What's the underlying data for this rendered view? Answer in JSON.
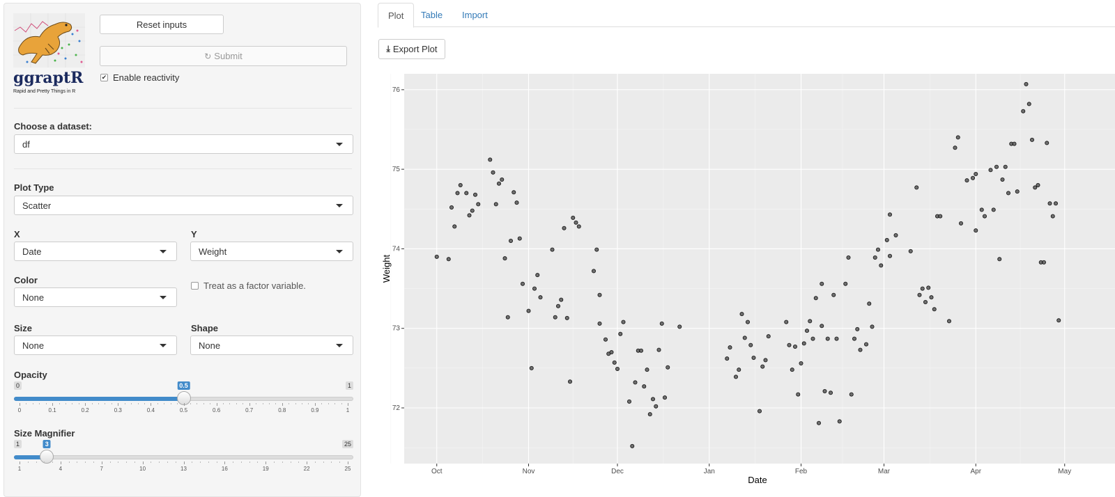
{
  "app": {
    "logo_title": "ggraptR",
    "logo_subtitle": "Rapid and Pretty Things in R"
  },
  "controls": {
    "reset_label": "Reset inputs",
    "submit_label": "Submit",
    "reactivity_label": "Enable reactivity",
    "reactivity_checked": true,
    "dataset_label": "Choose a dataset:",
    "dataset_value": "df",
    "plot_type_label": "Plot Type",
    "plot_type_value": "Scatter",
    "x_label": "X",
    "x_value": "Date",
    "y_label": "Y",
    "y_value": "Weight",
    "color_label": "Color",
    "color_value": "None",
    "factor_label": "Treat as a factor variable.",
    "factor_checked": false,
    "size_label": "Size",
    "size_value": "None",
    "shape_label": "Shape",
    "shape_value": "None"
  },
  "opacity_slider": {
    "label": "Opacity",
    "min": 0,
    "max": 1,
    "value": 0.5,
    "min_label": "0",
    "max_label": "1",
    "value_label": "0.5",
    "ticks": [
      "0",
      "0.1",
      "0.2",
      "0.3",
      "0.4",
      "0.5",
      "0.6",
      "0.7",
      "0.8",
      "0.9",
      "1"
    ]
  },
  "size_slider": {
    "label": "Size Magnifier",
    "min": 1,
    "max": 25,
    "value": 3,
    "min_label": "1",
    "max_label": "25",
    "value_label": "3",
    "ticks": [
      "1",
      "4",
      "7",
      "10",
      "13",
      "16",
      "19",
      "22",
      "25"
    ]
  },
  "tabs": [
    {
      "label": "Plot",
      "active": true
    },
    {
      "label": "Table",
      "active": false
    },
    {
      "label": "Import",
      "active": false
    }
  ],
  "export_label": "Export Plot",
  "colors": {
    "accent": "#428bca",
    "panel_bg": "#ebebeb",
    "point_fill": "#595959"
  },
  "chart_data": {
    "type": "scatter",
    "xlabel": "Date",
    "ylabel": "Weight",
    "x_ticks": [
      "Oct",
      "Nov",
      "Dec",
      "Jan",
      "Feb",
      "Mar",
      "Apr",
      "May"
    ],
    "x_tick_dates": [
      "2014-10-01",
      "2014-11-01",
      "2014-12-01",
      "2015-01-01",
      "2015-02-01",
      "2015-03-01",
      "2015-04-01",
      "2015-05-01"
    ],
    "y_ticks": [
      72,
      73,
      74,
      75,
      76
    ],
    "xlim": [
      "2014-09-20",
      "2015-05-18"
    ],
    "ylim": [
      71.3,
      76.2
    ],
    "grid": true,
    "points": [
      [
        "2014-10-01",
        73.9
      ],
      [
        "2014-10-05",
        73.87
      ],
      [
        "2014-10-06",
        74.52
      ],
      [
        "2014-10-07",
        74.28
      ],
      [
        "2014-10-08",
        74.7
      ],
      [
        "2014-10-09",
        74.8
      ],
      [
        "2014-10-11",
        74.7
      ],
      [
        "2014-10-12",
        74.42
      ],
      [
        "2014-10-13",
        74.48
      ],
      [
        "2014-10-14",
        74.68
      ],
      [
        "2014-10-15",
        74.56
      ],
      [
        "2014-10-19",
        75.12
      ],
      [
        "2014-10-20",
        74.96
      ],
      [
        "2014-10-21",
        74.56
      ],
      [
        "2014-10-22",
        74.82
      ],
      [
        "2014-10-23",
        74.87
      ],
      [
        "2014-10-24",
        73.88
      ],
      [
        "2014-10-25",
        73.14
      ],
      [
        "2014-10-26",
        74.1
      ],
      [
        "2014-10-27",
        74.71
      ],
      [
        "2014-10-28",
        74.58
      ],
      [
        "2014-10-29",
        74.13
      ],
      [
        "2014-10-30",
        73.56
      ],
      [
        "2014-11-01",
        73.22
      ],
      [
        "2014-11-02",
        72.5
      ],
      [
        "2014-11-03",
        73.5
      ],
      [
        "2014-11-04",
        73.67
      ],
      [
        "2014-11-05",
        73.39
      ],
      [
        "2014-11-09",
        73.99
      ],
      [
        "2014-11-10",
        73.14
      ],
      [
        "2014-11-11",
        73.28
      ],
      [
        "2014-11-12",
        73.36
      ],
      [
        "2014-11-13",
        74.26
      ],
      [
        "2014-11-14",
        73.13
      ],
      [
        "2014-11-15",
        72.33
      ],
      [
        "2014-11-16",
        74.39
      ],
      [
        "2014-11-17",
        74.33
      ],
      [
        "2014-11-18",
        74.28
      ],
      [
        "2014-11-23",
        73.72
      ],
      [
        "2014-11-24",
        73.99
      ],
      [
        "2014-11-25",
        73.06
      ],
      [
        "2014-11-25",
        73.42
      ],
      [
        "2014-11-27",
        72.86
      ],
      [
        "2014-11-28",
        72.68
      ],
      [
        "2014-11-29",
        72.7
      ],
      [
        "2014-11-30",
        72.57
      ],
      [
        "2014-12-01",
        72.49
      ],
      [
        "2014-12-02",
        72.93
      ],
      [
        "2014-12-03",
        73.08
      ],
      [
        "2014-12-05",
        72.08
      ],
      [
        "2014-12-06",
        71.52
      ],
      [
        "2014-12-07",
        72.32
      ],
      [
        "2014-12-08",
        72.72
      ],
      [
        "2014-12-09",
        72.72
      ],
      [
        "2014-12-10",
        72.27
      ],
      [
        "2014-12-11",
        72.48
      ],
      [
        "2014-12-12",
        71.92
      ],
      [
        "2014-12-13",
        72.11
      ],
      [
        "2014-12-14",
        72.02
      ],
      [
        "2014-12-15",
        72.73
      ],
      [
        "2014-12-16",
        73.06
      ],
      [
        "2014-12-17",
        72.13
      ],
      [
        "2014-12-18",
        72.51
      ],
      [
        "2014-12-22",
        73.02
      ],
      [
        "2015-01-07",
        72.62
      ],
      [
        "2015-01-08",
        72.76
      ],
      [
        "2015-01-10",
        72.39
      ],
      [
        "2015-01-11",
        72.48
      ],
      [
        "2015-01-12",
        73.18
      ],
      [
        "2015-01-13",
        72.88
      ],
      [
        "2015-01-14",
        73.08
      ],
      [
        "2015-01-15",
        72.79
      ],
      [
        "2015-01-16",
        72.63
      ],
      [
        "2015-01-18",
        71.96
      ],
      [
        "2015-01-19",
        72.52
      ],
      [
        "2015-01-20",
        72.6
      ],
      [
        "2015-01-21",
        72.9
      ],
      [
        "2015-01-27",
        73.08
      ],
      [
        "2015-01-28",
        72.79
      ],
      [
        "2015-01-29",
        72.48
      ],
      [
        "2015-01-30",
        72.77
      ],
      [
        "2015-01-31",
        72.17
      ],
      [
        "2015-02-01",
        72.56
      ],
      [
        "2015-02-02",
        72.81
      ],
      [
        "2015-02-03",
        72.97
      ],
      [
        "2015-02-04",
        73.09
      ],
      [
        "2015-02-05",
        72.87
      ],
      [
        "2015-02-06",
        73.38
      ],
      [
        "2015-02-07",
        71.81
      ],
      [
        "2015-02-08",
        73.03
      ],
      [
        "2015-02-08",
        73.56
      ],
      [
        "2015-02-09",
        72.21
      ],
      [
        "2015-02-10",
        72.87
      ],
      [
        "2015-02-11",
        72.19
      ],
      [
        "2015-02-12",
        73.42
      ],
      [
        "2015-02-13",
        72.87
      ],
      [
        "2015-02-14",
        71.83
      ],
      [
        "2015-02-16",
        73.56
      ],
      [
        "2015-02-17",
        73.89
      ],
      [
        "2015-02-18",
        72.17
      ],
      [
        "2015-02-19",
        72.87
      ],
      [
        "2015-02-20",
        72.99
      ],
      [
        "2015-02-21",
        72.73
      ],
      [
        "2015-02-23",
        72.8
      ],
      [
        "2015-02-24",
        73.31
      ],
      [
        "2015-02-25",
        73.02
      ],
      [
        "2015-02-26",
        73.89
      ],
      [
        "2015-02-27",
        73.99
      ],
      [
        "2015-02-28",
        73.79
      ],
      [
        "2015-03-02",
        74.11
      ],
      [
        "2015-03-03",
        73.91
      ],
      [
        "2015-03-03",
        74.43
      ],
      [
        "2015-03-05",
        74.17
      ],
      [
        "2015-03-10",
        73.97
      ],
      [
        "2015-03-12",
        74.77
      ],
      [
        "2015-03-13",
        73.42
      ],
      [
        "2015-03-14",
        73.5
      ],
      [
        "2015-03-15",
        73.33
      ],
      [
        "2015-03-16",
        73.51
      ],
      [
        "2015-03-17",
        73.39
      ],
      [
        "2015-03-18",
        73.24
      ],
      [
        "2015-03-19",
        74.41
      ],
      [
        "2015-03-20",
        74.41
      ],
      [
        "2015-03-23",
        73.09
      ],
      [
        "2015-03-25",
        75.27
      ],
      [
        "2015-03-26",
        75.4
      ],
      [
        "2015-03-27",
        74.32
      ],
      [
        "2015-03-29",
        74.86
      ],
      [
        "2015-03-31",
        74.89
      ],
      [
        "2015-04-01",
        74.94
      ],
      [
        "2015-04-01",
        74.23
      ],
      [
        "2015-04-03",
        74.49
      ],
      [
        "2015-04-04",
        74.41
      ],
      [
        "2015-04-06",
        74.99
      ],
      [
        "2015-04-07",
        74.49
      ],
      [
        "2015-04-08",
        75.03
      ],
      [
        "2015-04-09",
        73.87
      ],
      [
        "2015-04-10",
        74.87
      ],
      [
        "2015-04-11",
        75.03
      ],
      [
        "2015-04-12",
        74.7
      ],
      [
        "2015-04-13",
        75.32
      ],
      [
        "2015-04-14",
        75.32
      ],
      [
        "2015-04-15",
        74.72
      ],
      [
        "2015-04-17",
        75.73
      ],
      [
        "2015-04-18",
        76.07
      ],
      [
        "2015-04-19",
        75.82
      ],
      [
        "2015-04-20",
        75.37
      ],
      [
        "2015-04-21",
        74.77
      ],
      [
        "2015-04-22",
        74.8
      ],
      [
        "2015-04-23",
        73.83
      ],
      [
        "2015-04-24",
        73.83
      ],
      [
        "2015-04-25",
        75.33
      ],
      [
        "2015-04-26",
        74.57
      ],
      [
        "2015-04-27",
        74.41
      ],
      [
        "2015-04-28",
        74.57
      ],
      [
        "2015-04-29",
        73.1
      ]
    ]
  }
}
